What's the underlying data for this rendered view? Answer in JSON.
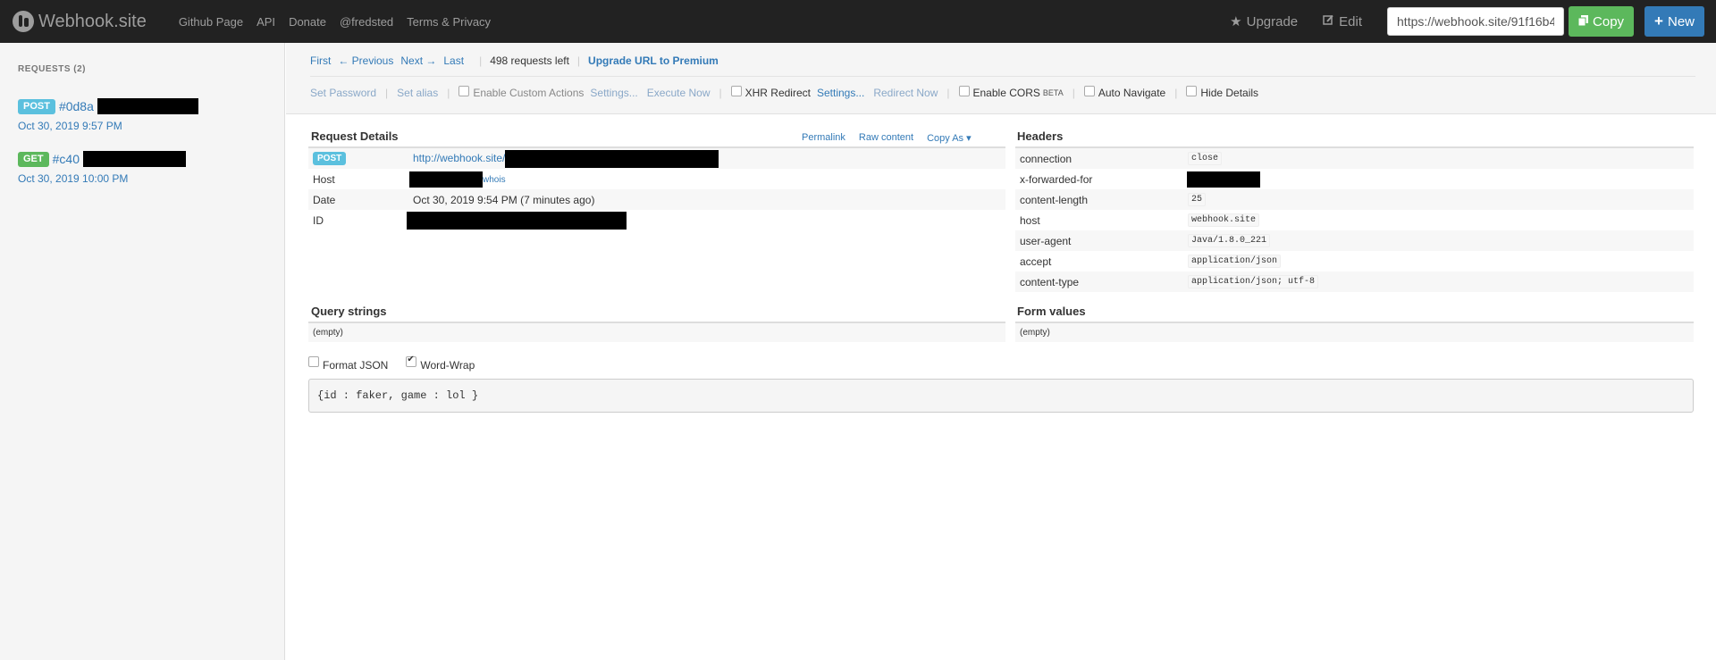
{
  "nav": {
    "brand": "Webhook.site",
    "links": [
      "Github Page",
      "API",
      "Donate",
      "@fredsted",
      "Terms & Privacy"
    ],
    "upgrade": "Upgrade",
    "edit": "Edit",
    "url_value": "https://webhook.site/91f16b4",
    "copy": "Copy",
    "new": "New"
  },
  "sidebar": {
    "heading": "REQUESTS (2)",
    "requests": [
      {
        "method": "POST",
        "id": "#0d8a",
        "date": "Oct 30, 2019 9:57 PM"
      },
      {
        "method": "GET",
        "id": "#c40",
        "date": "Oct 30, 2019 10:00 PM"
      }
    ]
  },
  "toolbar": {
    "first": "First",
    "previous": "← Previous",
    "next": "Next →",
    "last": "Last",
    "left": "498 requests left",
    "upgrade": "Upgrade URL to Premium",
    "set_password": "Set Password",
    "set_alias": "Set alias",
    "custom_actions": "Enable Custom Actions",
    "settings1": "Settings...",
    "execute_now": "Execute Now",
    "xhr_redirect": "XHR Redirect",
    "settings2": "Settings...",
    "redirect_now": "Redirect Now",
    "cors": "Enable CORS",
    "beta": "BETA",
    "auto_navigate": "Auto Navigate",
    "hide_details": "Hide Details"
  },
  "request_details": {
    "title": "Request Details",
    "permalink": "Permalink",
    "raw": "Raw content",
    "copy_as": "Copy As",
    "method": "POST",
    "url": "http://webhook.site/",
    "host_label": "Host",
    "whois": "whois",
    "date_label": "Date",
    "date_value": "Oct 30, 2019 9:54 PM (7 minutes ago)",
    "id_label": "ID"
  },
  "headers": {
    "title": "Headers",
    "rows": [
      {
        "k": "connection",
        "v": "close"
      },
      {
        "k": "x-forwarded-for",
        "v": ""
      },
      {
        "k": "content-length",
        "v": "25"
      },
      {
        "k": "host",
        "v": "webhook.site"
      },
      {
        "k": "user-agent",
        "v": "Java/1.8.0_221"
      },
      {
        "k": "accept",
        "v": "application/json"
      },
      {
        "k": "content-type",
        "v": "application/json; utf-8"
      }
    ]
  },
  "query": {
    "title": "Query strings",
    "empty": "(empty)"
  },
  "form": {
    "title": "Form values",
    "empty": "(empty)"
  },
  "options": {
    "format_json": "Format JSON",
    "word_wrap": "Word-Wrap"
  },
  "body": "{id : faker, game : lol }",
  "colors": {
    "nav_bg": "#222222",
    "link": "#337ab7",
    "post": "#5bc0de",
    "get": "#5cb85c",
    "new_btn": "#337ab7"
  }
}
